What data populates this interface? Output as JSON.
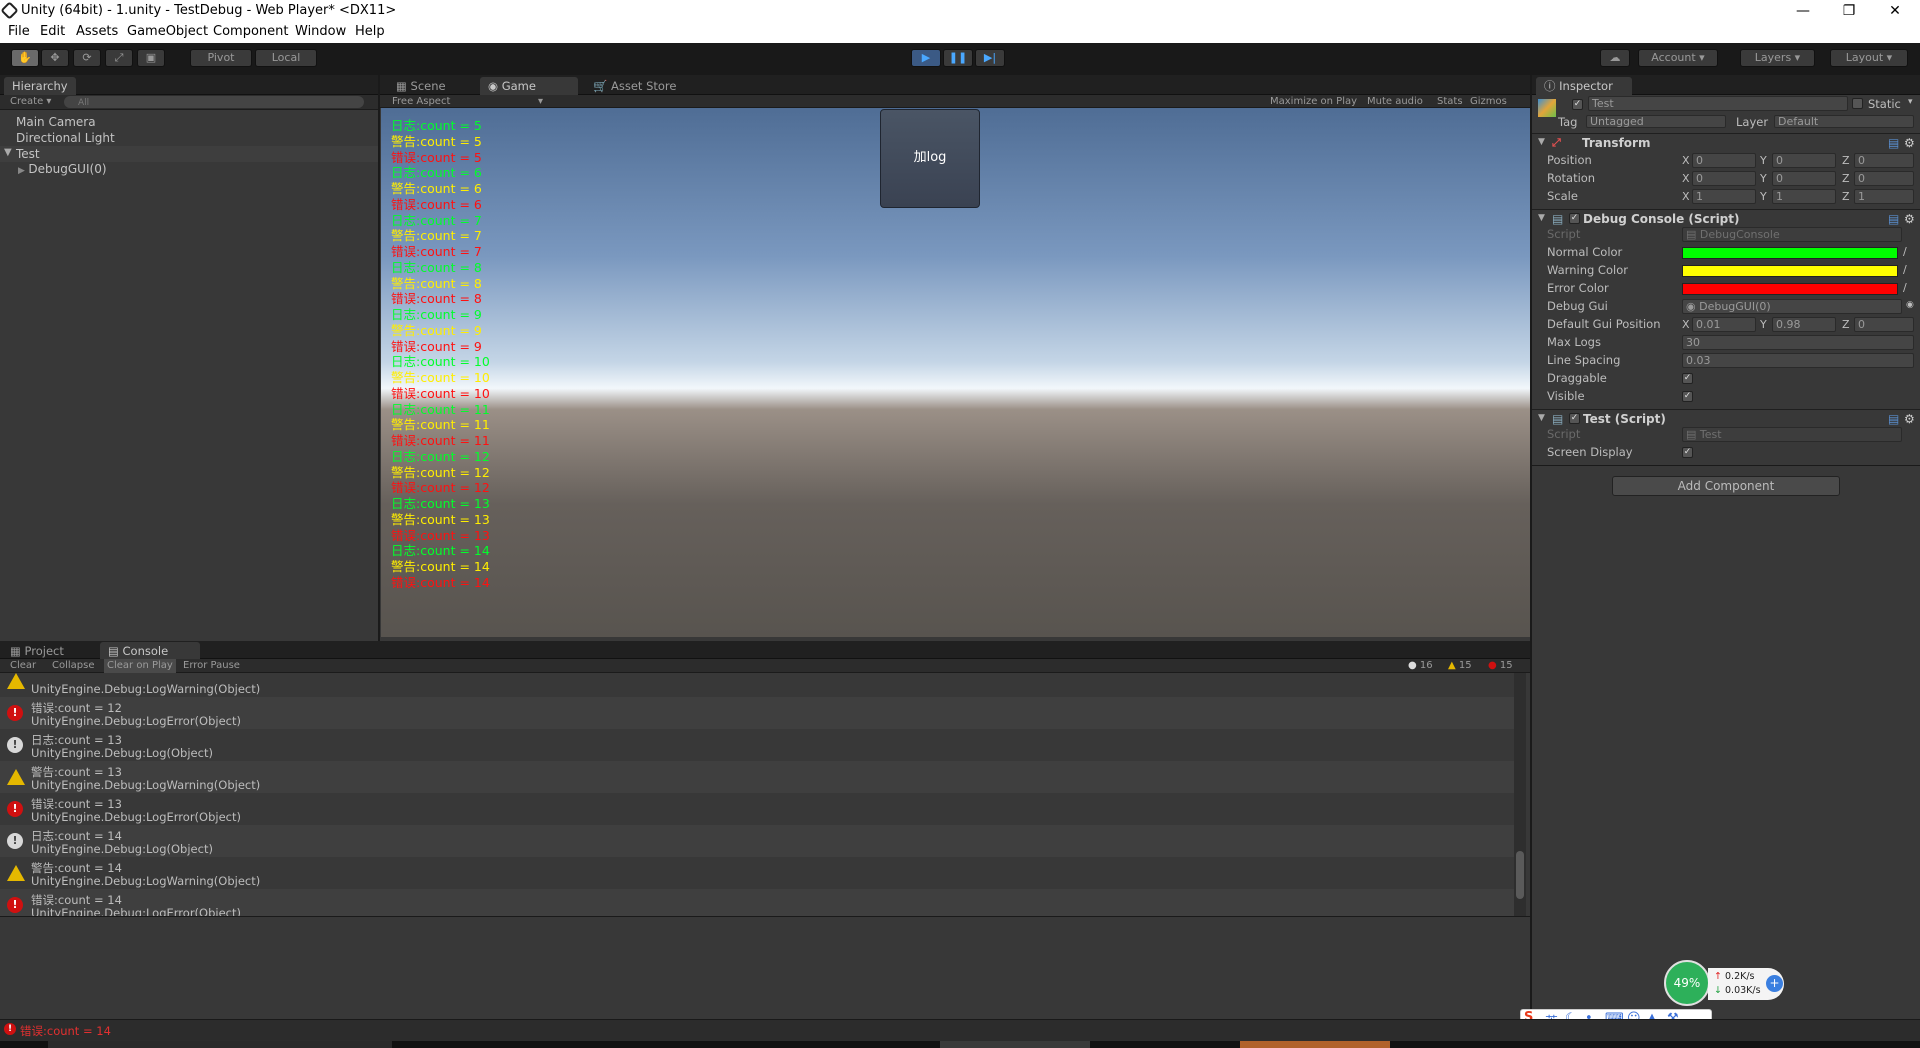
{
  "window": {
    "title": "Unity (64bit) - 1.unity - TestDebug - Web Player* <DX11>"
  },
  "menu": [
    "File",
    "Edit",
    "Assets",
    "GameObject",
    "Component",
    "Window",
    "Help"
  ],
  "toolbar": {
    "pivot": "Pivot",
    "local": "Local",
    "account": "Account",
    "layers": "Layers",
    "layout": "Layout"
  },
  "hierarchy": {
    "tab": "Hierarchy",
    "create": "Create",
    "search_placeholder": "All",
    "items": [
      "Main Camera",
      "Directional Light",
      "Test",
      "DebugGUI(0)"
    ]
  },
  "game": {
    "tabs": [
      "Scene",
      "Game",
      "Asset Store"
    ],
    "aspect": "Free Aspect",
    "options": [
      "Maximize on Play",
      "Mute audio",
      "Stats",
      "Gizmos"
    ],
    "button_label": "加log",
    "lines": [
      {
        "t": "日志:count = 5",
        "k": "N"
      },
      {
        "t": "警告:count = 5",
        "k": "W"
      },
      {
        "t": "错误:count = 5",
        "k": "E"
      },
      {
        "t": "日志:count = 6",
        "k": "N"
      },
      {
        "t": "警告:count = 6",
        "k": "W"
      },
      {
        "t": "错误:count = 6",
        "k": "E"
      },
      {
        "t": "日志:count = 7",
        "k": "N"
      },
      {
        "t": "警告:count = 7",
        "k": "W"
      },
      {
        "t": "错误:count = 7",
        "k": "E"
      },
      {
        "t": "日志:count = 8",
        "k": "N"
      },
      {
        "t": "警告:count = 8",
        "k": "W"
      },
      {
        "t": "错误:count = 8",
        "k": "E"
      },
      {
        "t": "日志:count = 9",
        "k": "N"
      },
      {
        "t": "警告:count = 9",
        "k": "W"
      },
      {
        "t": "错误:count = 9",
        "k": "E"
      },
      {
        "t": "日志:count = 10",
        "k": "N"
      },
      {
        "t": "警告:count = 10",
        "k": "W"
      },
      {
        "t": "错误:count = 10",
        "k": "E"
      },
      {
        "t": "日志:count = 11",
        "k": "N"
      },
      {
        "t": "警告:count = 11",
        "k": "W"
      },
      {
        "t": "错误:count = 11",
        "k": "E"
      },
      {
        "t": "日志:count = 12",
        "k": "N"
      },
      {
        "t": "警告:count = 12",
        "k": "W"
      },
      {
        "t": "错误:count = 12",
        "k": "E"
      },
      {
        "t": "日志:count = 13",
        "k": "N"
      },
      {
        "t": "警告:count = 13",
        "k": "W"
      },
      {
        "t": "错误:count = 13",
        "k": "E"
      },
      {
        "t": "日志:count = 14",
        "k": "N"
      },
      {
        "t": "警告:count = 14",
        "k": "W"
      },
      {
        "t": "错误:count = 14",
        "k": "E"
      }
    ]
  },
  "console": {
    "tabs": [
      "Project",
      "Console"
    ],
    "buttons": [
      "Clear",
      "Collapse",
      "Clear on Play",
      "Error Pause"
    ],
    "counts": {
      "log": "16",
      "warn": "15",
      "error": "15"
    },
    "partial_first": "UnityEngine.Debug:LogWarning(Object)",
    "entries": [
      {
        "type": "err",
        "msg": "错误:count = 12",
        "trace": "UnityEngine.Debug:LogError(Object)"
      },
      {
        "type": "log",
        "msg": "日志:count = 13",
        "trace": "UnityEngine.Debug:Log(Object)"
      },
      {
        "type": "warn",
        "msg": "警告:count = 13",
        "trace": "UnityEngine.Debug:LogWarning(Object)"
      },
      {
        "type": "err",
        "msg": "错误:count = 13",
        "trace": "UnityEngine.Debug:LogError(Object)"
      },
      {
        "type": "log",
        "msg": "日志:count = 14",
        "trace": "UnityEngine.Debug:Log(Object)"
      },
      {
        "type": "warn",
        "msg": "警告:count = 14",
        "trace": "UnityEngine.Debug:LogWarning(Object)"
      },
      {
        "type": "err",
        "msg": "错误:count = 14",
        "trace": "UnityEngine.Debug:LogError(Object)"
      }
    ]
  },
  "inspector": {
    "tab": "Inspector",
    "object_name": "Test",
    "static_label": "Static",
    "tag_label": "Tag",
    "tag_value": "Untagged",
    "layer_label": "Layer",
    "layer_value": "Default",
    "transform": {
      "title": "Transform",
      "rows": [
        {
          "label": "Position",
          "x": "0",
          "y": "0",
          "z": "0"
        },
        {
          "label": "Rotation",
          "x": "0",
          "y": "0",
          "z": "0"
        },
        {
          "label": "Scale",
          "x": "1",
          "y": "1",
          "z": "1"
        }
      ]
    },
    "debug_console": {
      "title": "Debug Console (Script)",
      "script_label": "Script",
      "script_value": "DebugConsole",
      "normal_color_label": "Normal Color",
      "normal_color": "#00ff00",
      "warning_color_label": "Warning Color",
      "warning_color": "#ffff00",
      "error_color_label": "Error Color",
      "error_color": "#ff0000",
      "debug_gui_label": "Debug Gui",
      "debug_gui_value": "DebugGUI(0)",
      "gui_pos_label": "Default Gui Position",
      "gui_pos_x": "0.01",
      "gui_pos_y": "0.98",
      "gui_pos_z": "0",
      "max_logs_label": "Max Logs",
      "max_logs": "30",
      "line_spacing_label": "Line Spacing",
      "line_spacing": "0.03",
      "draggable_label": "Draggable",
      "visible_label": "Visible"
    },
    "test_script": {
      "title": "Test (Script)",
      "script_label": "Script",
      "script_value": "Test",
      "screen_display_label": "Screen Display"
    },
    "add_component": "Add Component"
  },
  "overlay": {
    "percent": "49%",
    "up": "0.2K/s",
    "down": "0.03K/s",
    "ime": "英"
  },
  "status": {
    "text": "错误:count = 14"
  },
  "axes": {
    "x": "X",
    "y": "Y",
    "z": "Z"
  }
}
